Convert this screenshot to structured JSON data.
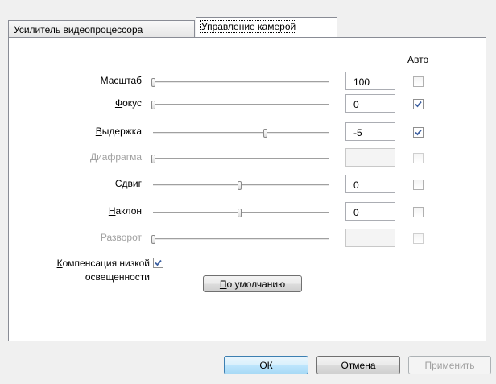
{
  "tabs": [
    {
      "label": "Усилитель видеопроцессора"
    },
    {
      "label": "Управление камерой"
    }
  ],
  "auto_header": "Авто",
  "controls": [
    {
      "label_pre": "Мас",
      "label_u": "ш",
      "label_post": "таб",
      "value": "100",
      "auto": false,
      "slider_position": 0.0,
      "enabled": true
    },
    {
      "label_pre": "",
      "label_u": "Ф",
      "label_post": "окус",
      "value": "0",
      "auto": true,
      "slider_position": 0.0,
      "enabled": true
    },
    {
      "label_pre": "",
      "label_u": "В",
      "label_post": "ыдержка",
      "value": "-5",
      "auto": true,
      "slider_position": 0.65,
      "enabled": true
    },
    {
      "label_pre": "",
      "label_u": "Д",
      "label_post": "иафрагма",
      "value": "",
      "auto": false,
      "slider_position": 0.0,
      "enabled": false
    },
    {
      "label_pre": "",
      "label_u": "С",
      "label_post": "двиг",
      "value": "0",
      "auto": false,
      "slider_position": 0.5,
      "enabled": true
    },
    {
      "label_pre": "",
      "label_u": "Н",
      "label_post": "аклон",
      "value": "0",
      "auto": false,
      "slider_position": 0.5,
      "enabled": true
    },
    {
      "label_pre": "",
      "label_u": "Р",
      "label_post": "азворот",
      "value": "",
      "auto": false,
      "slider_position": 0.0,
      "enabled": false
    }
  ],
  "low_light": {
    "line1_pre": "",
    "line1_u": "К",
    "line1_post": "омпенсация низкой",
    "line2": "освещенности",
    "checked": true
  },
  "defaults_button": {
    "pre": "",
    "u": "П",
    "post": "о умолчанию"
  },
  "buttons": {
    "ok": "ОК",
    "cancel": "Отмена",
    "apply_pre": "При",
    "apply_u": "м",
    "apply_post": "енить",
    "apply_enabled": false
  }
}
